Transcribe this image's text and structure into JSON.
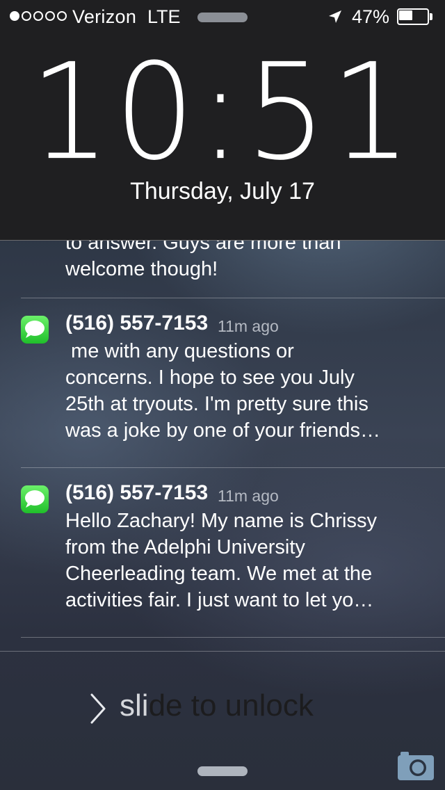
{
  "status_bar": {
    "signal_strength": 1,
    "signal_max": 5,
    "carrier": "Verizon",
    "network": "LTE",
    "battery_percent": "47%",
    "battery_level": 0.47,
    "icons": [
      "location-arrow-icon",
      "battery-icon"
    ]
  },
  "lock_screen": {
    "time": "10:51",
    "date": "Thursday, July 17"
  },
  "notifications": {
    "partial_top": {
      "lines": [
        "to answer. Guys are more than",
        "welcome though!"
      ]
    },
    "items": [
      {
        "app_icon": "messages-icon",
        "sender": "(516) 557-7153",
        "time": "11m ago",
        "lines": [
          " me with any questions or",
          "concerns. I hope to see you July",
          "25th at tryouts. I'm pretty sure this",
          "was a joke by one of your friends…"
        ]
      },
      {
        "app_icon": "messages-icon",
        "sender": "(516) 557-7153",
        "time": "11m ago",
        "lines": [
          "Hello Zachary! My name is Chrissy",
          "from the Adelphi University",
          "Cheerleading team. We met at the",
          "activities fair. I just want to let yo…"
        ]
      }
    ]
  },
  "unlock": {
    "label_start": "sli",
    "label_end": "de to unlock"
  },
  "colors": {
    "messages_green": "#1fbf2a",
    "clock_panel": "#1f1f21"
  }
}
